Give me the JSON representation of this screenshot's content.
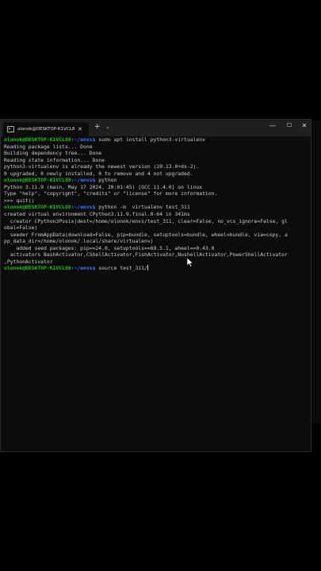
{
  "window": {
    "tab_title": "olonok@DESKTOP-K1VCL8:",
    "tab_icon": ">_",
    "tab_close": "✕",
    "new_tab": "+",
    "tab_menu": "⌄",
    "btn_min": "—",
    "btn_max": "☐",
    "btn_close": "✕"
  },
  "terminal": {
    "lines": [
      {
        "type": "prompt",
        "user": "olonok@DESKTOP-K1VCL88",
        "path": ":~/envs$",
        "cmd": " sudo apt install python3-virtualenv"
      },
      {
        "type": "out",
        "text": "Reading package lists... Done"
      },
      {
        "type": "out",
        "text": "Building dependency tree... Done"
      },
      {
        "type": "out",
        "text": "Reading state information... Done"
      },
      {
        "type": "out",
        "text": "python3-virtualenv is already the newest version (20.13.0+ds-2)."
      },
      {
        "type": "out",
        "text": "0 upgraded, 0 newly installed, 0 to remove and 4 not upgraded."
      },
      {
        "type": "prompt",
        "user": "olonok@DESKTOP-K1VCL88",
        "path": ":~/envs$",
        "cmd": " python"
      },
      {
        "type": "out",
        "text": "Python 3.11.9 (main, May 17 2024, 20:01:45) [GCC 11.4.0] on linux"
      },
      {
        "type": "out",
        "text": "Type \"help\", \"copyright\", \"credits\" or \"license\" for more information."
      },
      {
        "type": "out",
        "text": ">>> quit()"
      },
      {
        "type": "prompt",
        "user": "olonok@DESKTOP-K1VCL88",
        "path": ":~/envs$",
        "cmd": " python -m  virtualenv test_311"
      },
      {
        "type": "out",
        "text": "created virtual environment CPython3.11.9.final.0-64 in 341ms"
      },
      {
        "type": "out",
        "text": "  creator CPython3Posix(dest=/home/olonok/envs/test_311, clear=False, no_vcs_ignore=False, gl"
      },
      {
        "type": "out",
        "text": "obal=False)"
      },
      {
        "type": "out",
        "text": "  seeder FromAppData(download=False, pip=bundle, setuptools=bundle, wheel=bundle, via=copy, a"
      },
      {
        "type": "out",
        "text": "pp_data_dir=/home/olonok/.local/share/virtualenv)"
      },
      {
        "type": "out",
        "text": "    added seed packages: pip==24.0, setuptools==69.5.1, wheel==0.43.0"
      },
      {
        "type": "out",
        "text": "  activators BashActivator,CShellActivator,FishActivator,NushellActivator,PowerShellActivator"
      },
      {
        "type": "out",
        "text": ",PythonActivator"
      },
      {
        "type": "prompt",
        "user": "olonok@DESKTOP-K1VCL88",
        "path": ":~/envs$",
        "cmd": " source test_311/"
      }
    ]
  },
  "colors": {
    "user": "#16c60c",
    "path": "#3b78ff",
    "text": "#cccccc",
    "background": "#0c0c0c"
  }
}
